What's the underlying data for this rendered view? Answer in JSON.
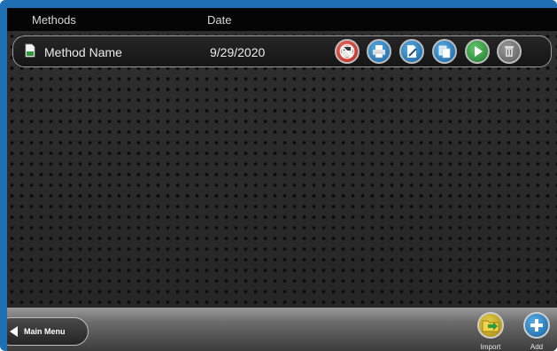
{
  "header": {
    "col_methods": "Methods",
    "col_date": "Date"
  },
  "rows": [
    {
      "name": "Method Name",
      "date": "9/29/2020",
      "icon": "document-icon"
    }
  ],
  "row_actions": [
    {
      "name": "delete-method-button",
      "icon": "no-floppy-icon",
      "color": "#d43a2f"
    },
    {
      "name": "print-method-button",
      "icon": "printer-icon",
      "color": "#1d7fc4"
    },
    {
      "name": "edit-method-button",
      "icon": "edit-document-icon",
      "color": "#1d7fc4"
    },
    {
      "name": "copy-method-button",
      "icon": "copy-icon",
      "color": "#1d7fc4"
    },
    {
      "name": "run-method-button",
      "icon": "play-icon",
      "color": "#2e9b3a"
    },
    {
      "name": "trash-method-button",
      "icon": "trash-icon",
      "color": "#7a7a7a"
    }
  ],
  "footer": {
    "main_menu": "Main Menu",
    "import": "Import",
    "add": "Add"
  },
  "colors": {
    "frame": "#1e6fb4",
    "header": "#050505",
    "accent_blue": "#1d7fc4",
    "accent_green": "#2e9b3a",
    "accent_red": "#d43a2f"
  }
}
